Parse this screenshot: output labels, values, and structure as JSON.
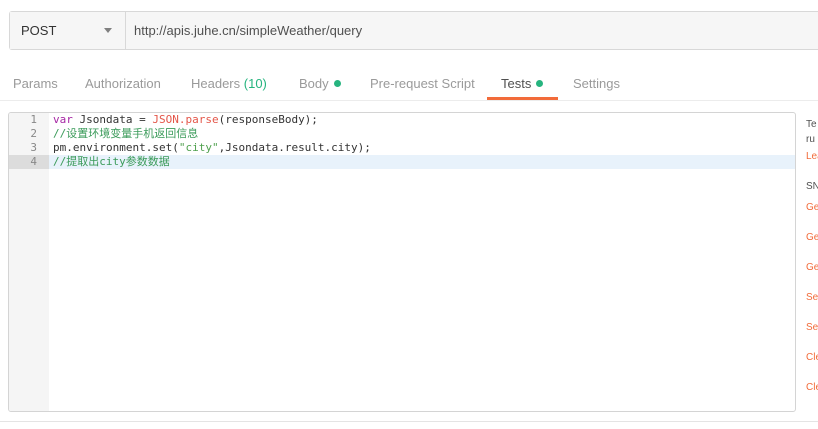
{
  "request": {
    "method": "POST",
    "url": "http://apis.juhe.cn/simpleWeather/query"
  },
  "tabs": [
    {
      "label": "Params"
    },
    {
      "label": "Authorization"
    },
    {
      "label": "Headers",
      "count": "(10)"
    },
    {
      "label": "Body",
      "has_dot": true
    },
    {
      "label": "Pre-request Script"
    },
    {
      "label": "Tests",
      "has_dot": true,
      "active": true
    },
    {
      "label": "Settings"
    }
  ],
  "editor": {
    "line_numbers": [
      "1",
      "2",
      "3",
      "4"
    ],
    "active_line": "4",
    "lines": [
      {
        "t1": "var",
        "t2": " Jsondata = ",
        "t3": "JSON.parse",
        "t4": "(responseBody);"
      },
      {
        "t1": "//设置环境变量手机返回信息"
      },
      {
        "t1": "pm.environment.set(",
        "t2": "\"city\"",
        "t3": ",Jsondata.result.city);"
      },
      {
        "t1": "//提取出city参数数据"
      }
    ]
  },
  "sidebar": {
    "items": [
      "Te",
      "ru",
      "Lea",
      "SN",
      "Ge",
      "Ge",
      "Ge",
      "Se",
      "Se",
      "Cle",
      "Cle"
    ]
  },
  "colors": {
    "accent": "#f26b3a",
    "status_green": "#26b47f"
  }
}
